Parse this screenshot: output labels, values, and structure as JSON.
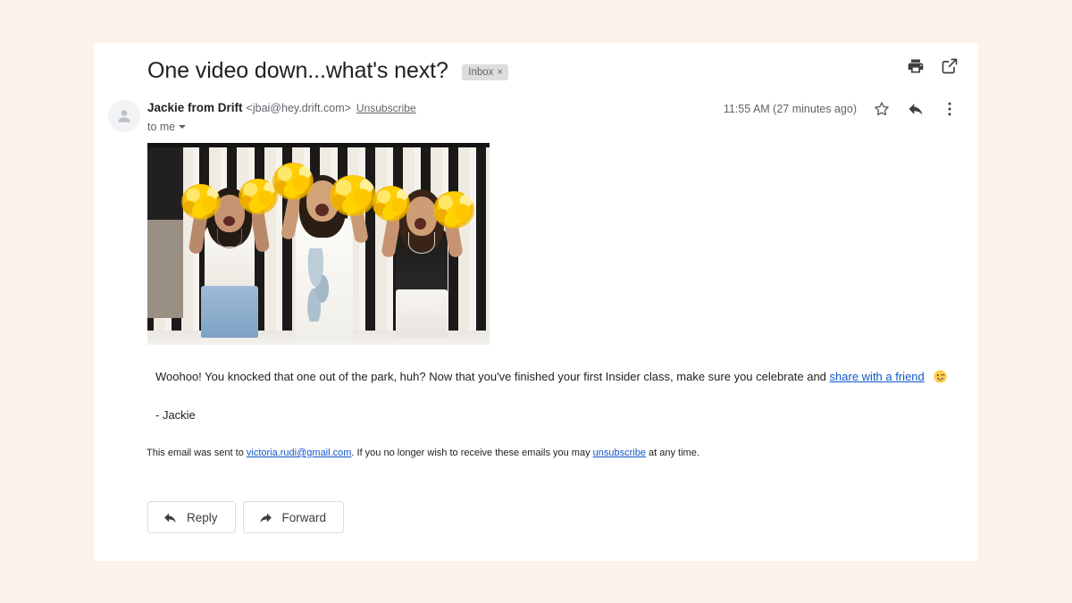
{
  "page": {
    "background_color": "#fdf1ec",
    "card_background": "#ffffff"
  },
  "email": {
    "subject": "One video down...what's next?",
    "label_chip": {
      "text": "Inbox",
      "remove": "×"
    },
    "header_actions": [
      {
        "name": "print-icon",
        "label": "Print"
      },
      {
        "name": "open-in-new-icon",
        "label": "Open in new window"
      }
    ],
    "sender": {
      "name": "Jackie from Drift",
      "email": "<jbai@hey.drift.com>",
      "unsubscribe_label": "Unsubscribe",
      "recipient": "to me"
    },
    "timestamp": "11:55 AM (27 minutes ago)",
    "message_actions": [
      {
        "name": "star-icon",
        "label": "Star"
      },
      {
        "name": "reply-icon",
        "label": "Reply"
      },
      {
        "name": "more-options-icon",
        "label": "More"
      }
    ],
    "image": {
      "alt": "Three women cheering and holding gold pom-poms in front of a black and white vertical slat wall"
    },
    "body": {
      "paragraph_before_link": "Woohoo! You knocked that one out of the park, huh? Now that you've finished your first Insider class, make sure you celebrate and ",
      "link_text": "share with a friend",
      "emoji": "winking-face",
      "signature": "- Jackie"
    },
    "footer": {
      "before_email": "This email was sent to ",
      "email_link": "victoria.rudi@gmail.com",
      "middle": ". If you no longer wish to receive these emails you may ",
      "unsubscribe_link": "unsubscribe",
      "after": " at any time."
    },
    "buttons": [
      {
        "name": "reply-button",
        "label": "Reply",
        "icon": "reply-arrow-icon"
      },
      {
        "name": "forward-button",
        "label": "Forward",
        "icon": "forward-arrow-icon"
      }
    ]
  },
  "colors": {
    "link_blue": "#1155cc",
    "chip_gray": "#ddddde",
    "text_primary": "#202124",
    "text_secondary": "#5f6368"
  }
}
